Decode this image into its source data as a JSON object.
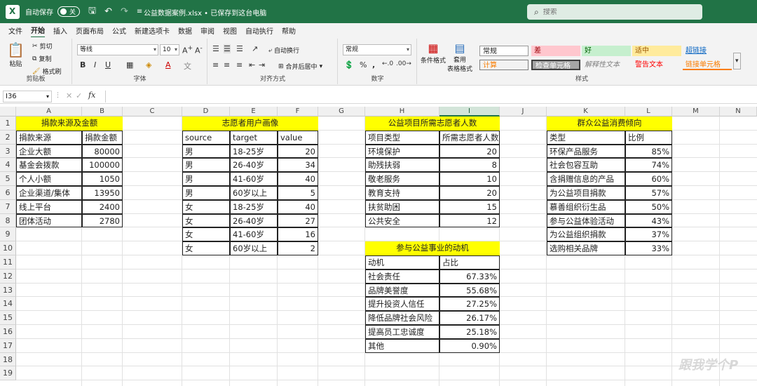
{
  "titlebar": {
    "autosave_label": "自动保存",
    "toggle_state": "关",
    "filename": "公益数据案例.xlsx • 已保存到这台电脑",
    "search_placeholder": "搜索"
  },
  "menu": [
    "文件",
    "开始",
    "插入",
    "页面布局",
    "公式",
    "新建选项卡",
    "数据",
    "审阅",
    "视图",
    "自动执行",
    "帮助"
  ],
  "ribbon": {
    "clipboard": {
      "paste": "粘贴",
      "cut": "剪切",
      "copy": "复制",
      "format_painter": "格式刷",
      "label": "剪贴板"
    },
    "font": {
      "name": "等线",
      "size": "10",
      "label": "字体"
    },
    "alignment": {
      "wrap": "自动换行",
      "merge": "合并后居中",
      "label": "对齐方式"
    },
    "number": {
      "format": "常规",
      "label": "数字"
    },
    "styles_group": {
      "conditional": "条件格式",
      "table": "套用",
      "table2": "表格格式",
      "label": "样式"
    },
    "styles": [
      {
        "name": "常规",
        "bg": "#ffffff",
        "fg": "#222222"
      },
      {
        "name": "差",
        "bg": "#ffc7ce",
        "fg": "#9c0006"
      },
      {
        "name": "好",
        "bg": "#c6efce",
        "fg": "#006100"
      },
      {
        "name": "适中",
        "bg": "#ffeb9c",
        "fg": "#9c5700"
      },
      {
        "name": "超链接",
        "bg": "#f3f3f3",
        "fg": "#0563c1"
      },
      {
        "name": "计算",
        "bg": "#f2f2f2",
        "fg": "#fa7d00"
      },
      {
        "name": "检查单元格",
        "bg": "#a5a5a5",
        "fg": "#ffffff"
      },
      {
        "name": "解释性文本",
        "bg": "#f3f3f3",
        "fg": "#7f7f7f"
      },
      {
        "name": "警告文本",
        "bg": "#f3f3f3",
        "fg": "#ff0000"
      },
      {
        "name": "链接单元格",
        "bg": "#f3f3f3",
        "fg": "#fa7d00"
      }
    ]
  },
  "formula": {
    "namebox": "I36",
    "fx": "fx"
  },
  "columns": [
    "A",
    "B",
    "C",
    "D",
    "E",
    "F",
    "G",
    "H",
    "I",
    "J",
    "K",
    "L",
    "M",
    "N"
  ],
  "rows": [
    "1",
    "2",
    "3",
    "4",
    "5",
    "6",
    "7",
    "8",
    "9",
    "10",
    "11",
    "12",
    "13",
    "14",
    "15",
    "16",
    "17",
    "18",
    "19"
  ],
  "tables": {
    "donation": {
      "title": "捐款来源及金额",
      "headers": [
        "捐款来源",
        "捐款金额"
      ],
      "rows": [
        [
          "企业大额",
          "80000"
        ],
        [
          "基金会拨款",
          "100000"
        ],
        [
          "个人小额",
          "1050"
        ],
        [
          "企业渠道/集体",
          "13950"
        ],
        [
          "线上平台",
          "2400"
        ],
        [
          "团体活动",
          "2780"
        ]
      ]
    },
    "volunteer": {
      "title": "志愿者用户画像",
      "headers": [
        "source",
        "target",
        "value"
      ],
      "rows": [
        [
          "男",
          "18-25岁",
          "20"
        ],
        [
          "男",
          "26-40岁",
          "34"
        ],
        [
          "男",
          "41-60岁",
          "40"
        ],
        [
          "男",
          "60岁以上",
          "5"
        ],
        [
          "女",
          "18-25岁",
          "40"
        ],
        [
          "女",
          "26-40岁",
          "27"
        ],
        [
          "女",
          "41-60岁",
          "16"
        ],
        [
          "女",
          "60岁以上",
          "2"
        ]
      ]
    },
    "projects": {
      "title": "公益项目所需志愿者人数",
      "headers": [
        "项目类型",
        "所需志愿者人数"
      ],
      "rows": [
        [
          "环境保护",
          "20"
        ],
        [
          "助残扶弱",
          "8"
        ],
        [
          "敬老服务",
          "10"
        ],
        [
          "教育支持",
          "20"
        ],
        [
          "扶贫助困",
          "15"
        ],
        [
          "公共安全",
          "12"
        ]
      ]
    },
    "motivation": {
      "title": "参与公益事业的动机",
      "headers": [
        "动机",
        "占比"
      ],
      "rows": [
        [
          "社会责任",
          "67.33%"
        ],
        [
          "品牌美誉度",
          "55.68%"
        ],
        [
          "提升投资人信任",
          "27.25%"
        ],
        [
          "降低品牌社会风险",
          "26.17%"
        ],
        [
          "提高员工忠诚度",
          "25.18%"
        ],
        [
          "其他",
          "0.90%"
        ]
      ]
    },
    "consumption": {
      "title": "群众公益消费倾向",
      "headers": [
        "类型",
        "比例"
      ],
      "rows": [
        [
          "环保产品服务",
          "85%"
        ],
        [
          "社会包容互助",
          "74%"
        ],
        [
          "含捐赠信息的产品",
          "60%"
        ],
        [
          "为公益项目捐款",
          "57%"
        ],
        [
          "慕善组织衍生品",
          "50%"
        ],
        [
          "参与公益体验活动",
          "43%"
        ],
        [
          "为公益组织捐款",
          "37%"
        ],
        [
          "选购相关品牌",
          "33%"
        ]
      ]
    }
  },
  "watermark": "跟我学个P"
}
